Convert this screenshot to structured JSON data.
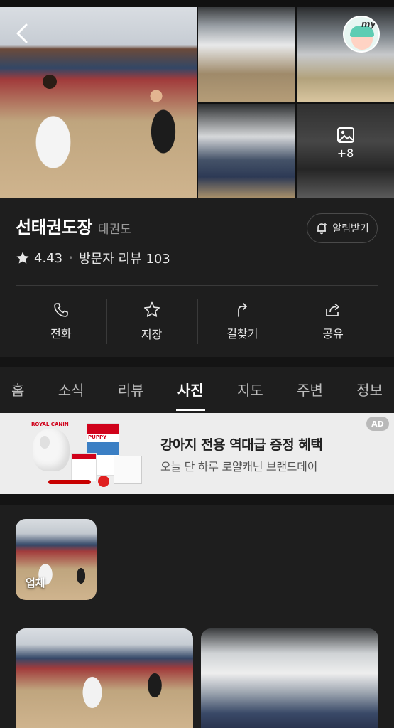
{
  "hero": {
    "more_photos_count": "+8",
    "my_label": "my"
  },
  "place": {
    "name": "선태권도장",
    "category": "태권도",
    "rating": "4.43",
    "review_text": "방문자 리뷰 103",
    "alert_label": "알림받기"
  },
  "actions": [
    {
      "label": "전화",
      "icon": "phone-icon"
    },
    {
      "label": "저장",
      "icon": "star-icon"
    },
    {
      "label": "길찾기",
      "icon": "directions-icon"
    },
    {
      "label": "공유",
      "icon": "share-icon"
    }
  ],
  "tabs": [
    "홈",
    "소식",
    "리뷰",
    "사진",
    "지도",
    "주변",
    "정보"
  ],
  "active_tab": "사진",
  "ad": {
    "badge": "AD",
    "title": "강아지 전용 역대급 증정 혜택",
    "subtitle": "오늘 단 하루 로얄캐닌 브랜드데이",
    "brand": "ROYAL CANIN",
    "product_label": "PUPPY"
  },
  "photos": {
    "owner_label": "업체"
  },
  "colors": {
    "background": "#1e1e1e",
    "text": "#ffffff",
    "muted": "#9a9a9a",
    "ad_background": "#ededed"
  }
}
